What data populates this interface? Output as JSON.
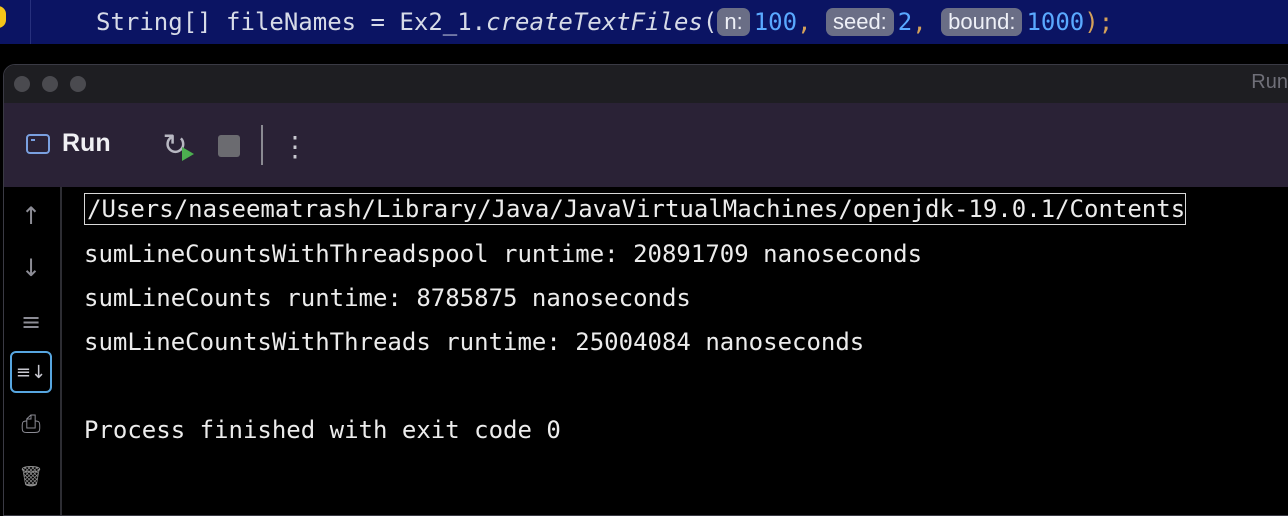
{
  "editor": {
    "code_prefix": "String[] fileNames = Ex2_1.",
    "method": "createTextFiles",
    "open_paren": "(",
    "params": [
      {
        "hint": "n:",
        "value": "100",
        "sep": ", "
      },
      {
        "hint": "seed:",
        "value": "2",
        "sep": ", "
      },
      {
        "hint": "bound:",
        "value": "1000",
        "sep": ""
      }
    ],
    "close": ");"
  },
  "window": {
    "title": "Run"
  },
  "toolbar": {
    "tab_label": "Run",
    "tab_icon": "console-window-icon",
    "rerun_icon": "rerun-icon",
    "stop_icon": "stop-icon",
    "more_icon": "more-vertical-icon"
  },
  "side_actions": [
    {
      "name": "scroll-up-icon",
      "glyph": "↑"
    },
    {
      "name": "scroll-down-icon",
      "glyph": "↓"
    },
    {
      "name": "soft-wrap-icon",
      "glyph": "≡"
    },
    {
      "name": "scroll-to-end-icon",
      "glyph": "≡↓",
      "active": true
    },
    {
      "name": "print-icon",
      "glyph": "⎙"
    },
    {
      "name": "trash-icon",
      "glyph": "🗑"
    }
  ],
  "console": {
    "lines": [
      "/Users/naseematrash/Library/Java/JavaVirtualMachines/openjdk-19.0.1/Contents",
      "sumLineCountsWithThreadspool runtime: 20891709 nanoseconds",
      "sumLineCounts runtime: 8785875 nanoseconds",
      "sumLineCountsWithThreads runtime: 25004084 nanoseconds",
      "",
      "Process finished with exit code 0"
    ]
  },
  "colors": {
    "editor_bg": "#0b1463",
    "toolbar_bg": "#2a2236",
    "console_bg": "#000000",
    "number": "#5aa9ff",
    "focus": "#57a6e0"
  }
}
